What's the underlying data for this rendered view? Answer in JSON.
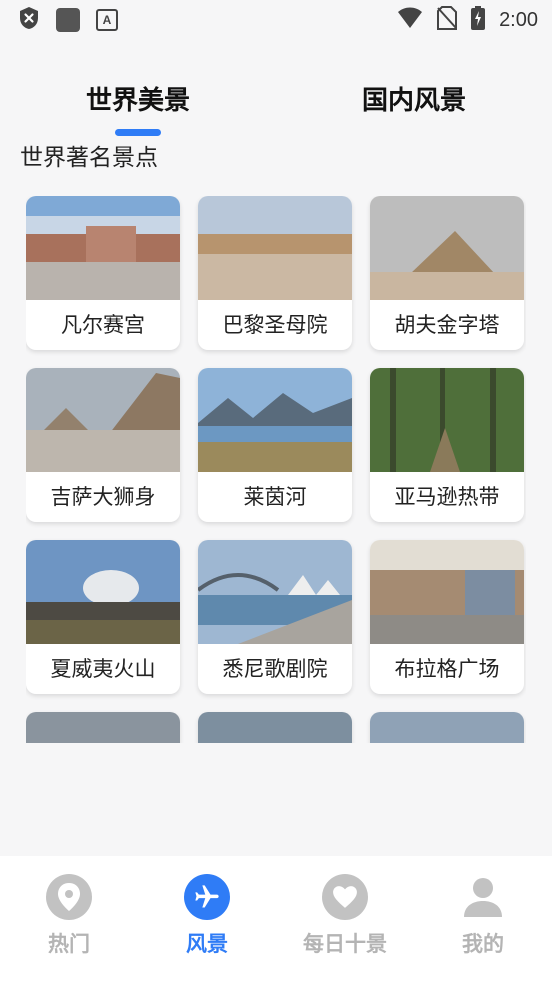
{
  "status_bar": {
    "time": "2:00",
    "badge_letter": "A"
  },
  "tabs": [
    {
      "label": "世界美景",
      "active": true
    },
    {
      "label": "国内风景",
      "active": false
    }
  ],
  "section_title": "世界著名景点",
  "cards": [
    {
      "label": "凡尔赛宫"
    },
    {
      "label": "巴黎圣母院"
    },
    {
      "label": "胡夫金字塔"
    },
    {
      "label": "吉萨大狮身"
    },
    {
      "label": "莱茵河"
    },
    {
      "label": "亚马逊热带"
    },
    {
      "label": "夏威夷火山"
    },
    {
      "label": "悉尼歌剧院"
    },
    {
      "label": "布拉格广场"
    }
  ],
  "bottom_nav": [
    {
      "label": "热门",
      "icon": "location-pin-icon",
      "active": false
    },
    {
      "label": "风景",
      "icon": "airplane-icon",
      "active": true
    },
    {
      "label": "每日十景",
      "icon": "heart-icon",
      "active": false
    },
    {
      "label": "我的",
      "icon": "user-icon",
      "active": false
    }
  ],
  "colors": {
    "accent": "#2f7cf6",
    "inactive": "#b4b4b4"
  }
}
